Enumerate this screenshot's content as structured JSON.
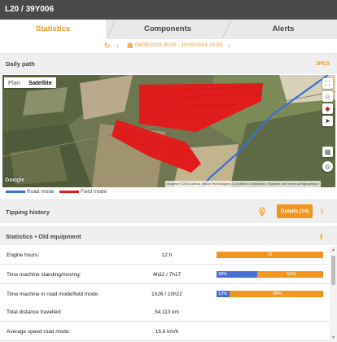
{
  "window": {
    "title": "L20 / 39Y006"
  },
  "tabs": [
    {
      "label": "Statistics",
      "active": true
    },
    {
      "label": "Components",
      "active": false
    },
    {
      "label": "Alerts",
      "active": false
    }
  ],
  "datebar": {
    "range": "09/09/2024 00:00 - 10/09/2024 23:59"
  },
  "daily_path": {
    "title": "Daily path",
    "export_label": "JPEG",
    "map_type": {
      "plan": "Plan",
      "satellite": "Satellite",
      "selected": "Satellite"
    },
    "google_logo": "Google",
    "attribution": "Imagerie ©2024 Airbus, Maxar Technologies | Conditions d'utilisation | Signaler une erreur cartographique",
    "legend": [
      {
        "label": "Road mode",
        "color": "#3a6fd8"
      },
      {
        "label": "Field mode",
        "color": "#e02020"
      }
    ]
  },
  "tipping_history": {
    "title": "Tipping history",
    "details_label": "Details (14)"
  },
  "statistics": {
    "title": "Statistics",
    "subtitle": "Old equipment",
    "rows": [
      {
        "label": "Engine hours:",
        "value": "12 h",
        "bar": [
          {
            "label": "12",
            "fraction": 1.0,
            "color": "#f0961e"
          }
        ]
      },
      {
        "label": "Time machine standing/moving:",
        "value": "4h32 / 7h17",
        "bar": [
          {
            "label": "38%",
            "fraction": 0.38,
            "color": "#4a6fd4"
          },
          {
            "label": "62%",
            "fraction": 0.62,
            "color": "#f0961e"
          }
        ]
      },
      {
        "label": "Time machine in road mode/field mode:",
        "value": "1h26 / 10h22",
        "bar": [
          {
            "label": "12%",
            "fraction": 0.12,
            "color": "#4a6fd4"
          },
          {
            "label": "88%",
            "fraction": 0.88,
            "color": "#f0961e"
          }
        ]
      },
      {
        "label": "Total distance travelled:",
        "value": "54.113 km"
      },
      {
        "label": "Average speed road mode:",
        "value": "16.6 km/h"
      }
    ]
  },
  "colors": {
    "accent": "#f0961e",
    "header": "#4a4a4a",
    "road": "#3a6fd8",
    "field": "#e02020"
  },
  "icons": [
    "refresh-icon",
    "chevron-left-icon",
    "calendar-icon",
    "chevron-right-icon",
    "fullscreen-icon",
    "pegman-icon",
    "compass-icon",
    "locate-icon",
    "layers-icon",
    "location-pin-icon",
    "download-icon"
  ]
}
